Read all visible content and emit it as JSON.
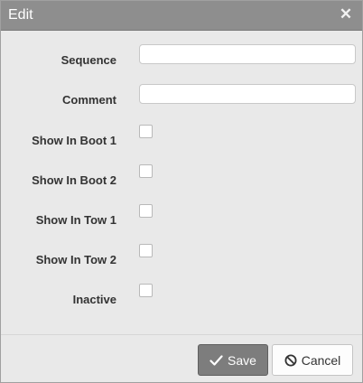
{
  "dialog": {
    "title": "Edit",
    "close_icon": "close-icon"
  },
  "form": {
    "fields": [
      {
        "label": "Sequence",
        "type": "text",
        "value": ""
      },
      {
        "label": "Comment",
        "type": "text",
        "value": ""
      },
      {
        "label": "Show In Boot 1",
        "type": "checkbox",
        "checked": false
      },
      {
        "label": "Show In Boot 2",
        "type": "checkbox",
        "checked": false
      },
      {
        "label": "Show In Tow 1",
        "type": "checkbox",
        "checked": false
      },
      {
        "label": "Show In Tow 2",
        "type": "checkbox",
        "checked": false
      },
      {
        "label": "Inactive",
        "type": "checkbox",
        "checked": false
      }
    ]
  },
  "footer": {
    "save_label": "Save",
    "save_icon": "check-icon",
    "cancel_label": "Cancel",
    "cancel_icon": "ban-icon"
  },
  "colors": {
    "titlebar": "#8e8e8e",
    "dialog_bg": "#e9e9e9",
    "save_bg": "#7d7d7d"
  }
}
